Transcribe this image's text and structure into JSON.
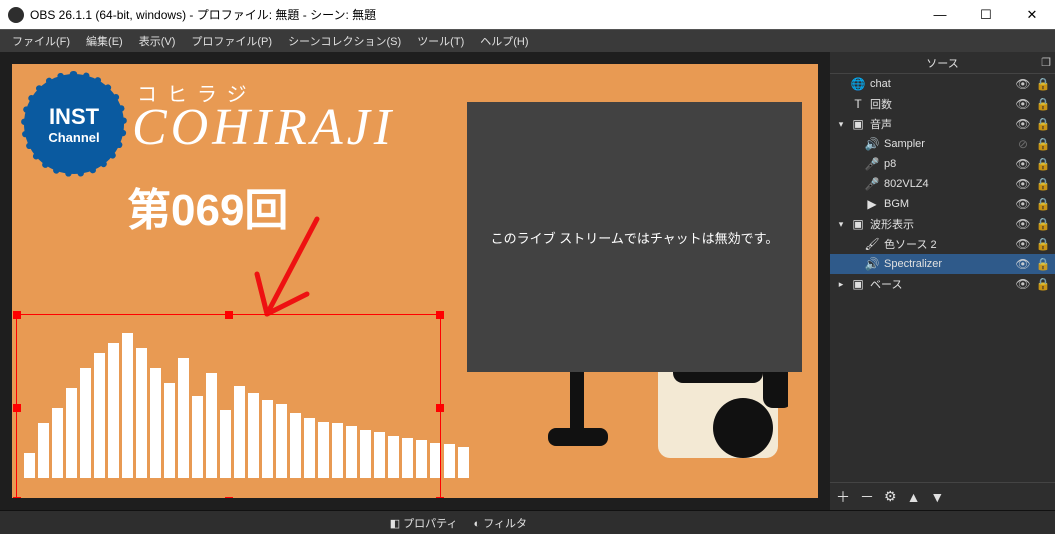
{
  "window": {
    "title": "OBS 26.1.1 (64-bit, windows) - プロファイル: 無題 - シーン: 無題"
  },
  "menu": {
    "file": "ファイル(F)",
    "edit": "編集(E)",
    "view": "表示(V)",
    "profile": "プロファイル(P)",
    "scenecoll": "シーンコレクション(S)",
    "tools": "ツール(T)",
    "help": "ヘルプ(H)"
  },
  "preview": {
    "badge_top": "INST",
    "badge_bottom": "Channel",
    "jp_sub": "コヒラジ",
    "latin": "COHIRAJI",
    "episode": "第069回",
    "overlay_msg": "このライブ ストリームではチャットは無効です。"
  },
  "sources_panel": {
    "title": "ソース",
    "items": [
      {
        "indent": 0,
        "chev": "",
        "icon": "globe",
        "label": "chat",
        "visible": true,
        "locked": true
      },
      {
        "indent": 0,
        "chev": "",
        "icon": "text",
        "label": "回数",
        "visible": true,
        "locked": true
      },
      {
        "indent": 0,
        "chev": "v",
        "icon": "folder",
        "label": "音声",
        "visible": true,
        "locked": true
      },
      {
        "indent": 1,
        "chev": "",
        "icon": "speaker",
        "label": "Sampler",
        "visible": false,
        "locked": true
      },
      {
        "indent": 1,
        "chev": "",
        "icon": "mic",
        "label": "p8",
        "visible": true,
        "locked": true
      },
      {
        "indent": 1,
        "chev": "",
        "icon": "mic",
        "label": "802VLZ4",
        "visible": true,
        "locked": true
      },
      {
        "indent": 1,
        "chev": "",
        "icon": "play",
        "label": "BGM",
        "visible": true,
        "locked": true
      },
      {
        "indent": 0,
        "chev": "v",
        "icon": "folder",
        "label": "波形表示",
        "visible": true,
        "locked": true
      },
      {
        "indent": 1,
        "chev": "",
        "icon": "brush",
        "label": "色ソース 2",
        "visible": true,
        "locked": true
      },
      {
        "indent": 1,
        "chev": "",
        "icon": "speaker",
        "label": "Spectralizer",
        "visible": true,
        "locked": true,
        "selected": true
      },
      {
        "indent": 0,
        "chev": ">",
        "icon": "folder",
        "label": "ベース",
        "visible": true,
        "locked": true
      }
    ]
  },
  "bottom": {
    "properties": "プロパティ",
    "filters": "フィルタ"
  },
  "chart_data": {
    "type": "bar",
    "title": "Spectralizer audio bars",
    "values": [
      25,
      55,
      70,
      90,
      110,
      125,
      135,
      145,
      130,
      110,
      95,
      120,
      82,
      105,
      68,
      92,
      85,
      78,
      74,
      65,
      60,
      56,
      55,
      52,
      48,
      46,
      42,
      40,
      38,
      35,
      34,
      31
    ],
    "ylim": [
      0,
      160
    ]
  },
  "icons": {
    "globe": "🌐",
    "text": "T",
    "folder": "▣",
    "speaker": "🔊",
    "mic": "🎤",
    "play": "▶",
    "brush": "🖌"
  }
}
